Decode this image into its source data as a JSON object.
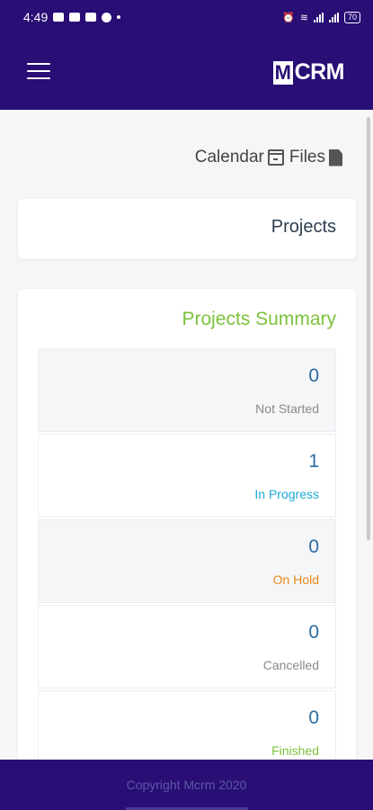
{
  "status_bar": {
    "time": "4:49",
    "battery": "70"
  },
  "app_bar": {
    "logo_mark": "M",
    "logo_text": "CRM"
  },
  "quick_links": {
    "calendar_label": "Calendar",
    "files_label": "Files"
  },
  "projects_card": {
    "title": "Projects"
  },
  "summary": {
    "title": "Projects Summary",
    "stats": [
      {
        "value": "0",
        "label": "Not Started",
        "label_color": "#8a8a8a",
        "bg": "#f5f6f8"
      },
      {
        "value": "1",
        "label": "In Progress",
        "label_color": "#1ea8d8",
        "bg": "#ffffff"
      },
      {
        "value": "0",
        "label": "On Hold",
        "label_color": "#e88a1a",
        "bg": "#f5f6f8"
      },
      {
        "value": "0",
        "label": "Cancelled",
        "label_color": "#8a8a8a",
        "bg": "#ffffff"
      },
      {
        "value": "0",
        "label": "Finished",
        "label_color": "#7cc23d",
        "bg": "#ffffff"
      }
    ]
  },
  "footer": {
    "copyright": "Copyright Mcrm 2020"
  },
  "colors": {
    "brand": "#280e75",
    "accent_green": "#7cc23d",
    "value_blue": "#2b6ca3"
  }
}
